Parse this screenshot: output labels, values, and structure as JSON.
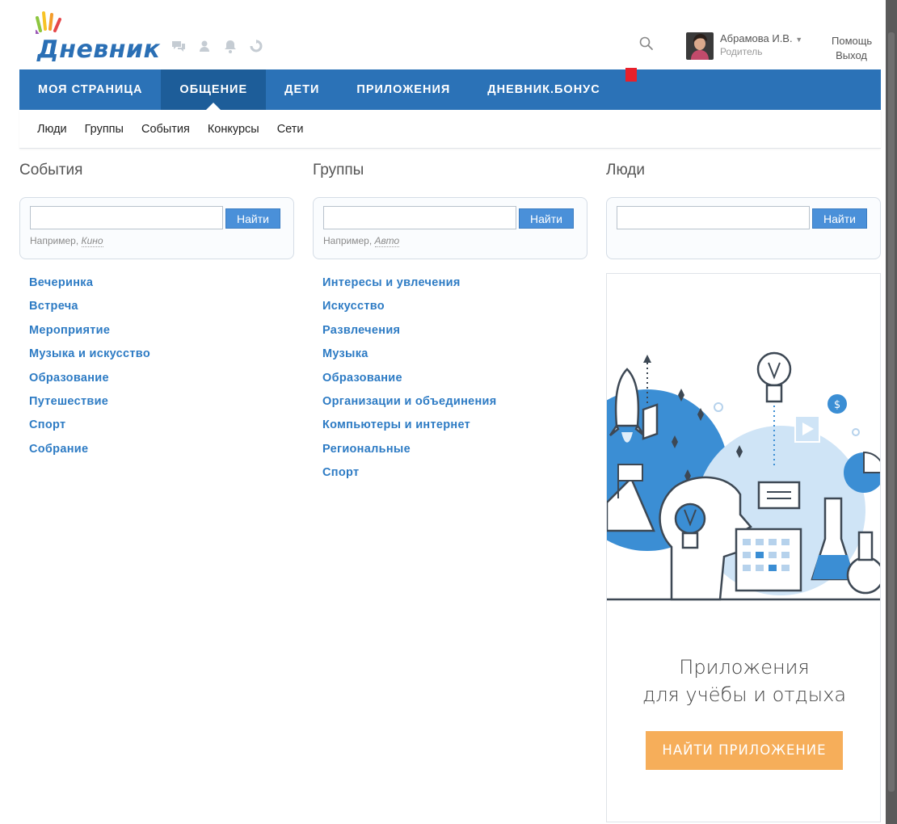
{
  "brand": {
    "logo_text": "Дневник",
    "accent": "#2b72b7"
  },
  "header": {
    "icons": [
      "chat-icon",
      "person-icon",
      "bell-icon",
      "refresh-icon"
    ],
    "user": {
      "name": "Абрамова И.В.",
      "role": "Родитель"
    },
    "links": {
      "help": "Помощь",
      "logout": "Выход"
    }
  },
  "nav": {
    "items": [
      {
        "label": "МОЯ СТРАНИЦА"
      },
      {
        "label": "ОБЩЕНИЕ"
      },
      {
        "label": "ДЕТИ"
      },
      {
        "label": "ПРИЛОЖЕНИЯ"
      },
      {
        "label": "ДНЕВНИК.БОНУС"
      }
    ],
    "active_index": 1
  },
  "subnav": {
    "items": [
      {
        "label": "Люди"
      },
      {
        "label": "Группы"
      },
      {
        "label": "События"
      },
      {
        "label": "Конкурсы"
      },
      {
        "label": "Сети"
      }
    ]
  },
  "events": {
    "title": "События",
    "search": {
      "button": "Найти",
      "hint_prefix": "Например,",
      "hint_example": "Кино"
    },
    "categories": [
      "Вечеринка",
      "Встреча",
      "Мероприятие",
      "Музыка и искусство",
      "Образование",
      "Путешествие",
      "Спорт",
      "Собрание"
    ]
  },
  "groups": {
    "title": "Группы",
    "search": {
      "button": "Найти",
      "hint_prefix": "Например,",
      "hint_example": "Авто"
    },
    "categories": [
      "Интересы и увлечения",
      "Искусство",
      "Развлечения",
      "Музыка",
      "Образование",
      "Организации и объединения",
      "Компьютеры и интернет",
      "Региональные",
      "Спорт"
    ]
  },
  "people": {
    "title": "Люди",
    "search": {
      "button": "Найти"
    }
  },
  "promo": {
    "title_line1": "Приложения",
    "title_line2": "для учёбы и отдыха",
    "button": "НАЙТИ ПРИЛОЖЕНИЕ"
  }
}
